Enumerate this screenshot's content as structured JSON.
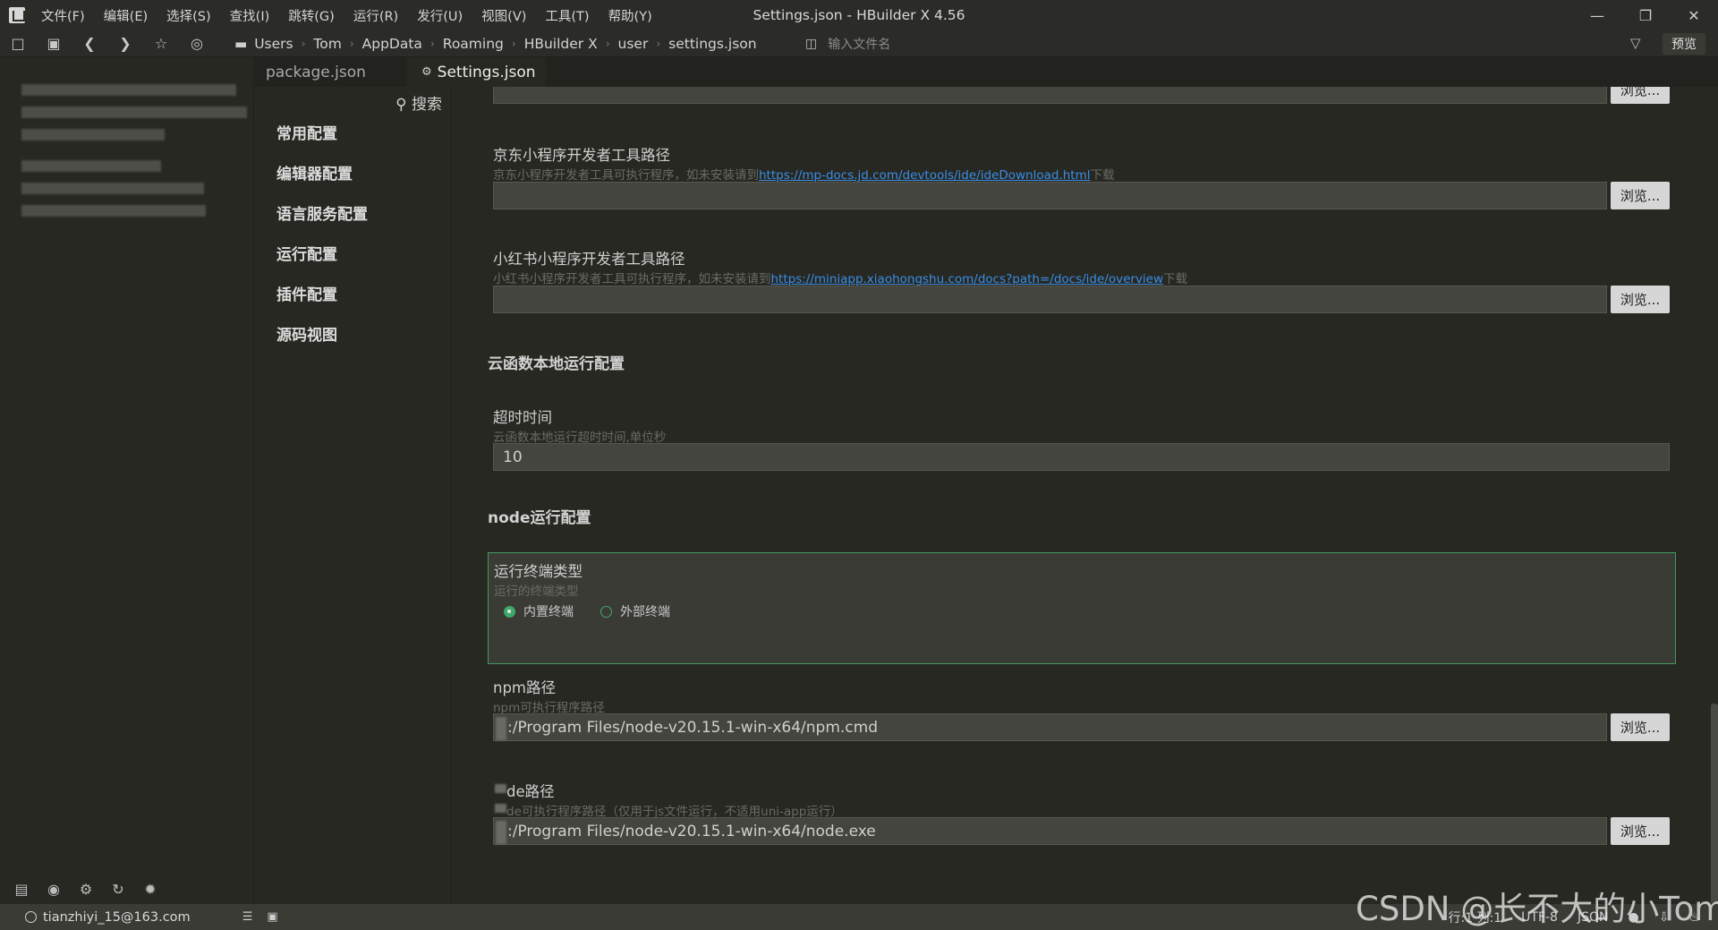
{
  "menu": {
    "items": [
      "文件(F)",
      "编辑(E)",
      "选择(S)",
      "查找(I)",
      "跳转(G)",
      "运行(R)",
      "发行(U)",
      "视图(V)",
      "工具(T)",
      "帮助(Y)"
    ],
    "window_title": "Settings.json - HBuilder X 4.56"
  },
  "breadcrumb": [
    "Users",
    "Tom",
    "AppData",
    "Roaming",
    "HBuilder X",
    "user",
    "settings.json"
  ],
  "toolbar": {
    "file_search_placeholder": "输入文件名",
    "preview_label": "预览"
  },
  "tabs": [
    {
      "label": "package.json",
      "active": false
    },
    {
      "label": "Settings.json",
      "active": true
    }
  ],
  "nav": {
    "search_label": "搜索",
    "items": [
      "常用配置",
      "编辑器配置",
      "语言服务配置",
      "运行配置",
      "插件配置",
      "源码视图"
    ]
  },
  "content": {
    "browse_label": "浏览...",
    "jd": {
      "label": "京东小程序开发者工具路径",
      "desc_prefix": "京东小程序开发者工具可执行程序，如未安装请到",
      "link": "https://mp-docs.jd.com/devtools/ide/ideDownload.html",
      "desc_suffix": "下载",
      "value": ""
    },
    "xhs": {
      "label": "小红书小程序开发者工具路径",
      "desc_prefix": "小红书小程序开发者工具可执行程序，如未安装请到",
      "link": "https://miniapp.xiaohongshu.com/docs?path=/docs/ide/overview",
      "desc_suffix": "下载",
      "value": ""
    },
    "cloud_section": "云函数本地运行配置",
    "timeout": {
      "label": "超时时间",
      "desc": "云函数本地运行超时时间,单位秒",
      "value": "10"
    },
    "node_section": "node运行配置",
    "terminal": {
      "label": "运行终端类型",
      "desc": "运行的终端类型",
      "options": [
        "内置终端",
        "外部终端"
      ],
      "selected": "内置终端"
    },
    "npm": {
      "label": "npm路径",
      "desc": "npm可执行程序路径",
      "value": ":/Program Files/node-v20.15.1-win-x64/npm.cmd"
    },
    "node": {
      "label": "de路径",
      "desc": "de可执行程序路径（仅用于js文件运行，不适用uni-app运行）",
      "value": ":/Program Files/node-v20.15.1-win-x64/node.exe"
    }
  },
  "status": {
    "user": "tianzhiyi_15@163.com",
    "position": "行:1  列:1",
    "encoding": "UTF-8",
    "lang": "JSON"
  },
  "watermark": "CSDN @长不大的小Tom",
  "colors": {
    "accent_green": "#3fa86b",
    "link": "#3a8ee6",
    "background": "#272822"
  }
}
